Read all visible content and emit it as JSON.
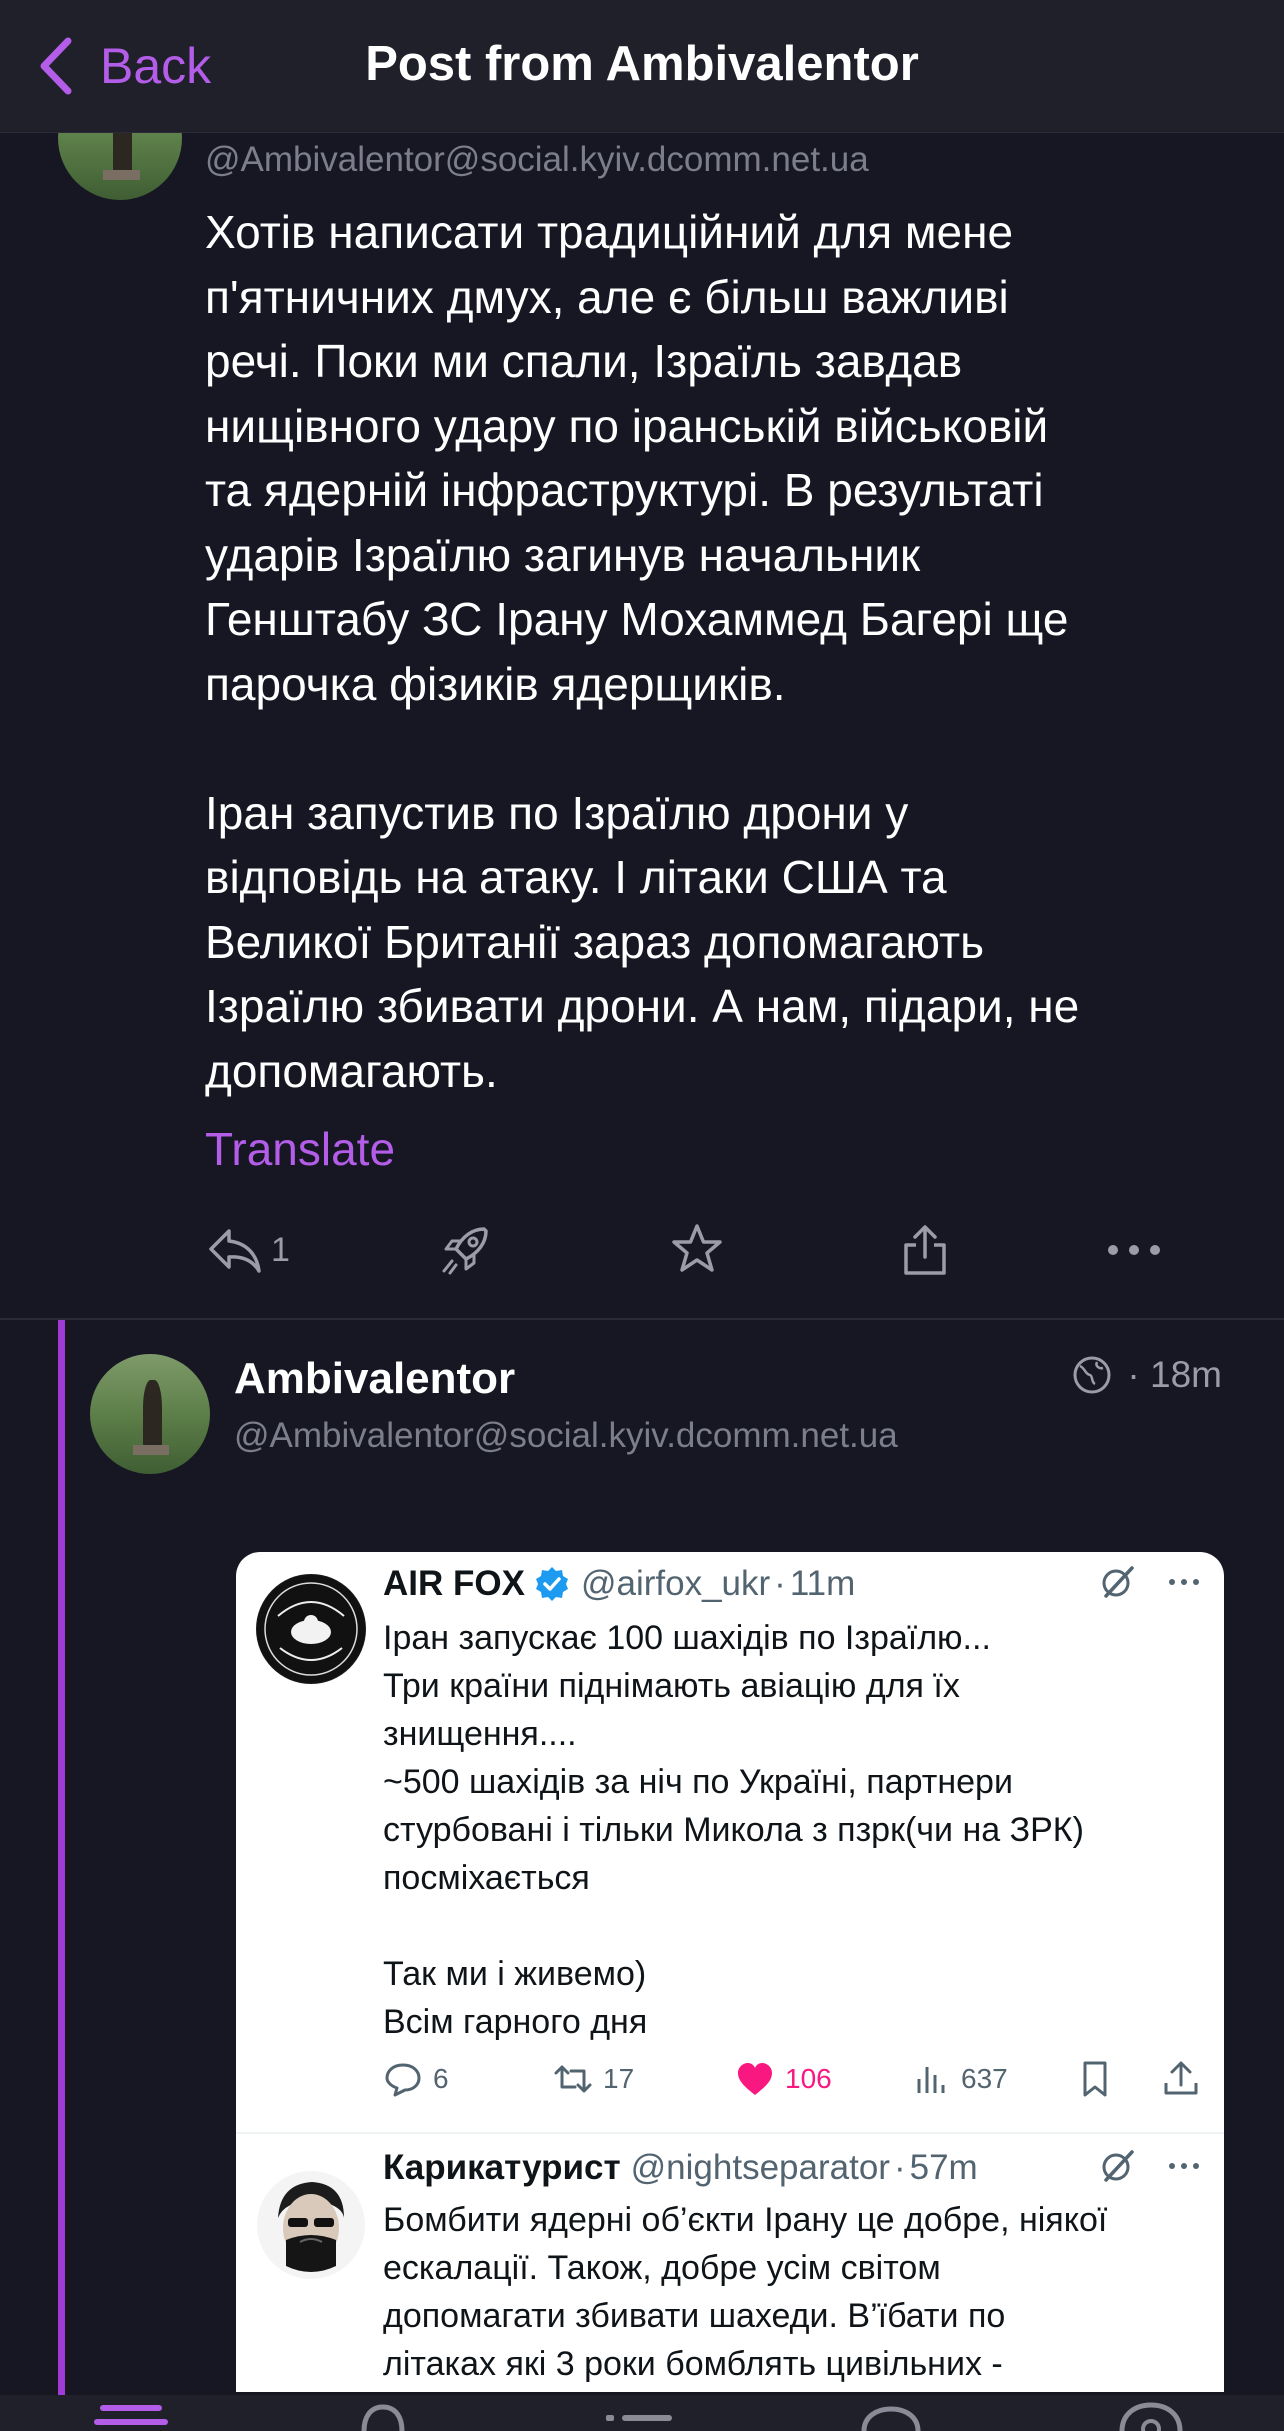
{
  "nav": {
    "back_label": "Back",
    "title": "Post from Ambivalentor"
  },
  "post": {
    "handle": "@Ambivalentor@social.kyiv.dcomm.net.ua",
    "text": "Хотів написати традиційний для мене\nп'ятничних дмух, але є більш важливі\nречі. Поки ми спали, Ізраїль завдав\nнищівного удару по іранській військовій\nта ядерній інфраструктурі. В результаті\nударів Ізраїлю загинув начальник\nГенштабу ЗС Ірану Мохаммед Багері ще\nпарочка фізиків ядерщиків.\n\nІран запустив по Ізраїлю дрони у\nвідповідь на атаку. І літаки США та\nВеликої Британії зараз допомагають\nІзраїлю збивати дрони. А нам, підари, не\nдопомагають.",
    "translate_label": "Translate",
    "reply_count": "1",
    "icons": [
      "reply-icon",
      "boost-icon",
      "favourite-icon",
      "share-icon",
      "more-icon"
    ]
  },
  "quoted_post": {
    "display_name": "Ambivalentor",
    "handle": "@Ambivalentor@social.kyiv.dcomm.net.ua",
    "time": "18m",
    "visibility_icon": "globe-icon",
    "screenshot": {
      "tweet1": {
        "name": "AIR FOX",
        "handle": "@airfox_ukr",
        "time": "11m",
        "avatar_text": "СЯЙВО В ТЕМРЯВІ",
        "text": "Іран запускає 100 шахідів по Ізраїлю...\nТри країни піднімають авіацію для їх\nзнищення....\n~500 шахідів за ніч по Україні, партнери\nстурбовані і тільки Микола з пзрк(чи на ЗРК)\nпосміхається\n\nТак ми і живемо)\nВсім гарного дня",
        "replies": "6",
        "retweets": "17",
        "likes": "106",
        "views": "637",
        "like_color": "#f91880"
      },
      "tweet2": {
        "name": "Карикатурист",
        "handle": "@nightseparator",
        "time": "57m",
        "text": "Бомбити ядерні об’єкти Ірану це добре, ніякої\nескалації. Також, добре усім світом\nдопомагати збивати шахеди. В’їбати по\nлітаках які 3 роки бомблять цивільних -"
      }
    }
  },
  "colors": {
    "accent": "#b35de8",
    "thread_line": "#a03bd8",
    "background": "#161723",
    "navbar": "#1f2029",
    "secondary_text": "#7d7e8c"
  },
  "tabbar": {
    "icons": [
      "home-icon",
      "notifications-icon",
      "lists-icon",
      "explore-icon",
      "profile-icon"
    ]
  }
}
